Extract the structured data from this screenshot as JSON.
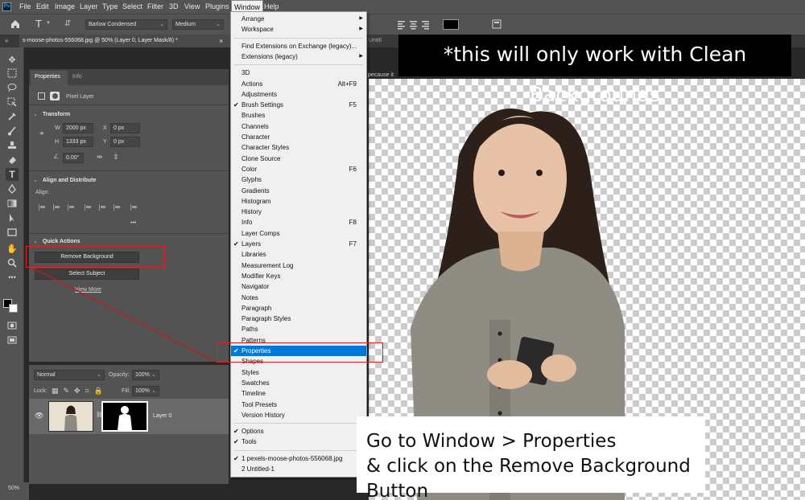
{
  "app": {
    "logo_text": "Ps"
  },
  "menubar": [
    "File",
    "Edit",
    "Image",
    "Layer",
    "Type",
    "Select",
    "Filter",
    "3D",
    "View",
    "Plugins",
    "Window",
    "Help"
  ],
  "options_bar": {
    "font_family": "Barlow Condensed",
    "font_style": "Medium"
  },
  "document_tab": {
    "title": "s-moose-photos-556068.jpg @ 50% (Layer 0, Layer Mask/8) *",
    "close": "×",
    "partial_text": "Untitl",
    "partial_text2": "pecause it"
  },
  "properties_panel": {
    "tabs": [
      "Properties",
      "Info"
    ],
    "layer_type": "Pixel Layer",
    "transform": {
      "title": "Transform",
      "w_label": "W",
      "w": "2000 px",
      "h_label": "H",
      "h": "1333 px",
      "x_label": "X",
      "x": "0 px",
      "y_label": "Y",
      "y": "0 px",
      "angle": "0.00°"
    },
    "align": {
      "title": "Align and Distribute",
      "label": "Align:",
      "more": "•••"
    },
    "quick_actions": {
      "title": "Quick Actions",
      "remove_bg": "Remove Background",
      "select_subject": "Select Subject",
      "view_more": "View More"
    }
  },
  "layers_panel": {
    "blend_mode": "Normal",
    "opacity_label": "Opacity:",
    "opacity": "100%",
    "lock_label": "Lock:",
    "fill_label": "Fill:",
    "fill": "100%",
    "layer_name": "Layer 0"
  },
  "window_menu": {
    "items": [
      {
        "label": "Arrange",
        "submenu": true,
        "checked": false,
        "shortcut": ""
      },
      {
        "label": "Workspace",
        "submenu": true,
        "checked": false,
        "shortcut": ""
      },
      {
        "sep": true
      },
      {
        "label": "Find Extensions on Exchange (legacy)...",
        "submenu": false,
        "checked": false,
        "shortcut": ""
      },
      {
        "label": "Extensions (legacy)",
        "submenu": true,
        "checked": false,
        "shortcut": ""
      },
      {
        "sep": true
      },
      {
        "label": "3D",
        "checked": false,
        "shortcut": ""
      },
      {
        "label": "Actions",
        "checked": false,
        "shortcut": "Alt+F9"
      },
      {
        "label": "Adjustments",
        "checked": false,
        "shortcut": ""
      },
      {
        "label": "Brush Settings",
        "checked": true,
        "shortcut": "F5"
      },
      {
        "label": "Brushes",
        "checked": false,
        "shortcut": ""
      },
      {
        "label": "Channels",
        "checked": false,
        "shortcut": ""
      },
      {
        "label": "Character",
        "checked": false,
        "shortcut": ""
      },
      {
        "label": "Character Styles",
        "checked": false,
        "shortcut": ""
      },
      {
        "label": "Clone Source",
        "checked": false,
        "shortcut": ""
      },
      {
        "label": "Color",
        "checked": false,
        "shortcut": "F6"
      },
      {
        "label": "Glyphs",
        "checked": false,
        "shortcut": ""
      },
      {
        "label": "Gradients",
        "checked": false,
        "shortcut": ""
      },
      {
        "label": "Histogram",
        "checked": false,
        "shortcut": ""
      },
      {
        "label": "History",
        "checked": false,
        "shortcut": ""
      },
      {
        "label": "Info",
        "checked": false,
        "shortcut": "F8"
      },
      {
        "label": "Layer Comps",
        "checked": false,
        "shortcut": ""
      },
      {
        "label": "Layers",
        "checked": true,
        "shortcut": "F7"
      },
      {
        "label": "Libraries",
        "checked": false,
        "shortcut": ""
      },
      {
        "label": "Measurement Log",
        "checked": false,
        "shortcut": ""
      },
      {
        "label": "Modifier Keys",
        "checked": false,
        "shortcut": ""
      },
      {
        "label": "Navigator",
        "checked": false,
        "shortcut": ""
      },
      {
        "label": "Notes",
        "checked": false,
        "shortcut": ""
      },
      {
        "label": "Paragraph",
        "checked": false,
        "shortcut": ""
      },
      {
        "label": "Paragraph Styles",
        "checked": false,
        "shortcut": ""
      },
      {
        "label": "Paths",
        "checked": false,
        "shortcut": ""
      },
      {
        "label": "Patterns",
        "checked": false,
        "shortcut": ""
      },
      {
        "label": "Properties",
        "checked": true,
        "shortcut": "",
        "selected": true
      },
      {
        "label": "Shapes",
        "checked": false,
        "shortcut": ""
      },
      {
        "label": "Styles",
        "checked": false,
        "shortcut": ""
      },
      {
        "label": "Swatches",
        "checked": false,
        "shortcut": ""
      },
      {
        "label": "Timeline",
        "checked": false,
        "shortcut": ""
      },
      {
        "label": "Tool Presets",
        "checked": false,
        "shortcut": ""
      },
      {
        "label": "Version History",
        "checked": false,
        "shortcut": ""
      },
      {
        "sep": true
      },
      {
        "label": "Options",
        "checked": true,
        "shortcut": ""
      },
      {
        "label": "Tools",
        "checked": true,
        "shortcut": ""
      },
      {
        "sep": true
      },
      {
        "label": "1 pexels-moose-photos-556068.jpg",
        "checked": true,
        "shortcut": ""
      },
      {
        "label": "2 Untitled-1",
        "checked": false,
        "shortcut": ""
      }
    ]
  },
  "annotations": {
    "banner": "*this will only work with Clean Backgrounds",
    "callout_line1": "Go  to Window > Properties",
    "callout_line2": "& click on the Remove Background Button"
  },
  "status": {
    "zoom": "50%"
  },
  "colors": {
    "highlight": "#0078d7",
    "red_box": "#e31e24"
  }
}
